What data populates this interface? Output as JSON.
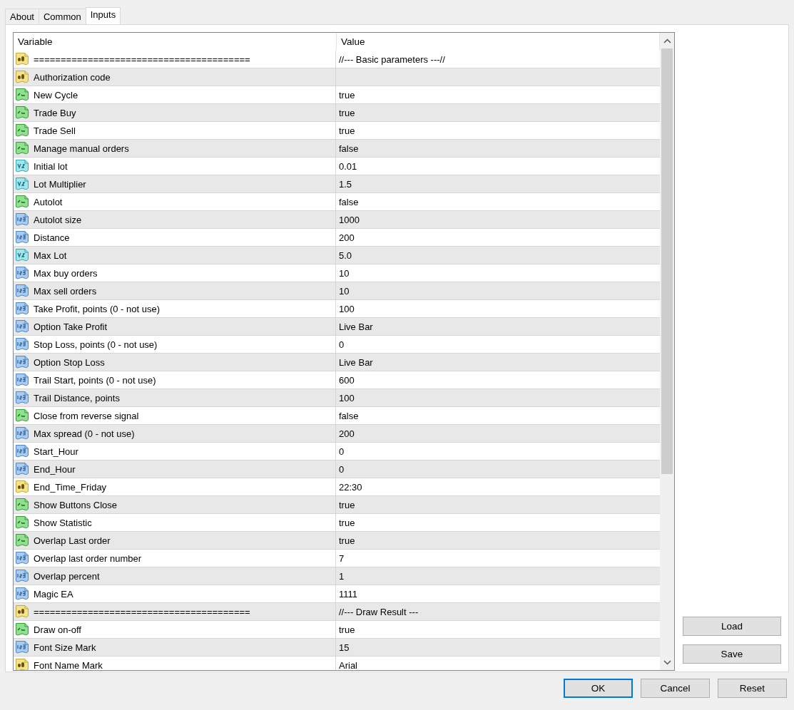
{
  "tabs": [
    {
      "label": "About",
      "selected": false
    },
    {
      "label": "Common",
      "selected": false
    },
    {
      "label": "Inputs",
      "selected": true
    }
  ],
  "table": {
    "columns": [
      "Variable",
      "Value"
    ],
    "rows": [
      {
        "kind": "string",
        "variable": "========================================",
        "value": "//--- Basic parameters ---//"
      },
      {
        "kind": "string",
        "variable": "Authorization code",
        "value": ""
      },
      {
        "kind": "bool",
        "variable": "New Cycle",
        "value": "true"
      },
      {
        "kind": "bool",
        "variable": "Trade Buy",
        "value": "true"
      },
      {
        "kind": "bool",
        "variable": "Trade Sell",
        "value": "true"
      },
      {
        "kind": "bool",
        "variable": "Manage manual orders",
        "value": "false"
      },
      {
        "kind": "double",
        "variable": "Initial lot",
        "value": "0.01"
      },
      {
        "kind": "double",
        "variable": "Lot Multiplier",
        "value": "1.5"
      },
      {
        "kind": "bool",
        "variable": "Autolot",
        "value": "false"
      },
      {
        "kind": "int",
        "variable": "Autolot size",
        "value": "1000"
      },
      {
        "kind": "int",
        "variable": "Distance",
        "value": "200"
      },
      {
        "kind": "double",
        "variable": "Max Lot",
        "value": "5.0"
      },
      {
        "kind": "int",
        "variable": "Max buy orders",
        "value": "10"
      },
      {
        "kind": "int",
        "variable": "Max sell orders",
        "value": "10"
      },
      {
        "kind": "int",
        "variable": "Take Profit, points (0 - not use)",
        "value": "100"
      },
      {
        "kind": "int",
        "variable": "Option Take Profit",
        "value": "Live Bar"
      },
      {
        "kind": "int",
        "variable": "Stop Loss, points (0 - not use)",
        "value": "0"
      },
      {
        "kind": "int",
        "variable": "Option Stop Loss",
        "value": "Live Bar"
      },
      {
        "kind": "int",
        "variable": "Trail Start, points (0 - not use)",
        "value": "600"
      },
      {
        "kind": "int",
        "variable": "Trail Distance, points",
        "value": "100"
      },
      {
        "kind": "bool",
        "variable": "Close from reverse signal",
        "value": "false"
      },
      {
        "kind": "int",
        "variable": "Max spread (0 - not use)",
        "value": "200"
      },
      {
        "kind": "int",
        "variable": "Start_Hour",
        "value": "0"
      },
      {
        "kind": "int",
        "variable": "End_Hour",
        "value": "0"
      },
      {
        "kind": "string",
        "variable": "End_Time_Friday",
        "value": "22:30"
      },
      {
        "kind": "bool",
        "variable": "Show Buttons Close",
        "value": "true"
      },
      {
        "kind": "bool",
        "variable": "Show Statistic",
        "value": "true"
      },
      {
        "kind": "bool",
        "variable": "Overlap Last order",
        "value": "true"
      },
      {
        "kind": "int",
        "variable": "Overlap last order number",
        "value": "7"
      },
      {
        "kind": "int",
        "variable": "Overlap percent",
        "value": "1"
      },
      {
        "kind": "int",
        "variable": "Magic EA",
        "value": "1111"
      },
      {
        "kind": "string",
        "variable": "========================================",
        "value": "//--- Draw Result ---"
      },
      {
        "kind": "bool",
        "variable": "Draw on-off",
        "value": "true"
      },
      {
        "kind": "int",
        "variable": "Font Size Mark",
        "value": "15"
      },
      {
        "kind": "string",
        "variable": "Font Name Mark",
        "value": "Arial"
      }
    ]
  },
  "side_buttons": [
    "Load",
    "Save"
  ],
  "buttons": [
    {
      "label": "OK",
      "focused": true
    },
    {
      "label": "Cancel",
      "focused": false
    },
    {
      "label": "Reset",
      "focused": false
    }
  ]
}
